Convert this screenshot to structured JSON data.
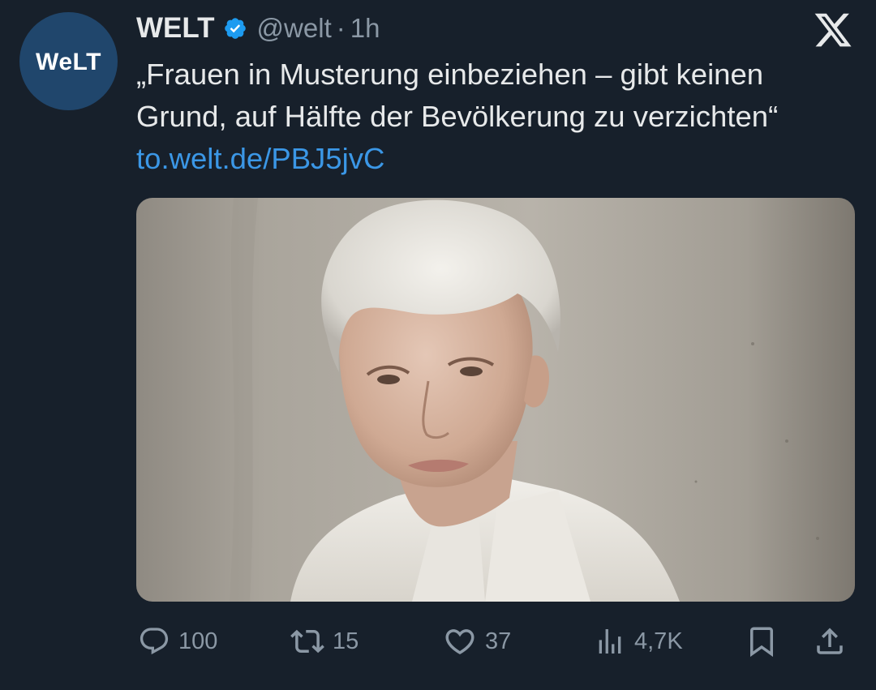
{
  "avatar": {
    "text": "WeLT",
    "color": "#20466c"
  },
  "header": {
    "display_name": "WELT",
    "verified_icon": "verified-badge-icon",
    "handle": "@welt",
    "separator": "·",
    "time": "1h"
  },
  "platform_icon": "x-logo-icon",
  "tweet": {
    "text": "„Frauen in Musterung einbeziehen – gibt keinen Grund, auf Hälfte der Bevölkerung zu verzichten“",
    "link": "to.welt.de/PBJ5jvC"
  },
  "media": {
    "description_icon": "portrait-photo"
  },
  "actions": {
    "replies": "100",
    "reposts": "15",
    "likes": "37",
    "views": "4,7K"
  },
  "colors": {
    "background": "#17202b",
    "text": "#e7e9ea",
    "muted": "#8b98a5",
    "link": "#3b97e6",
    "verified": "#1d9bf0"
  }
}
